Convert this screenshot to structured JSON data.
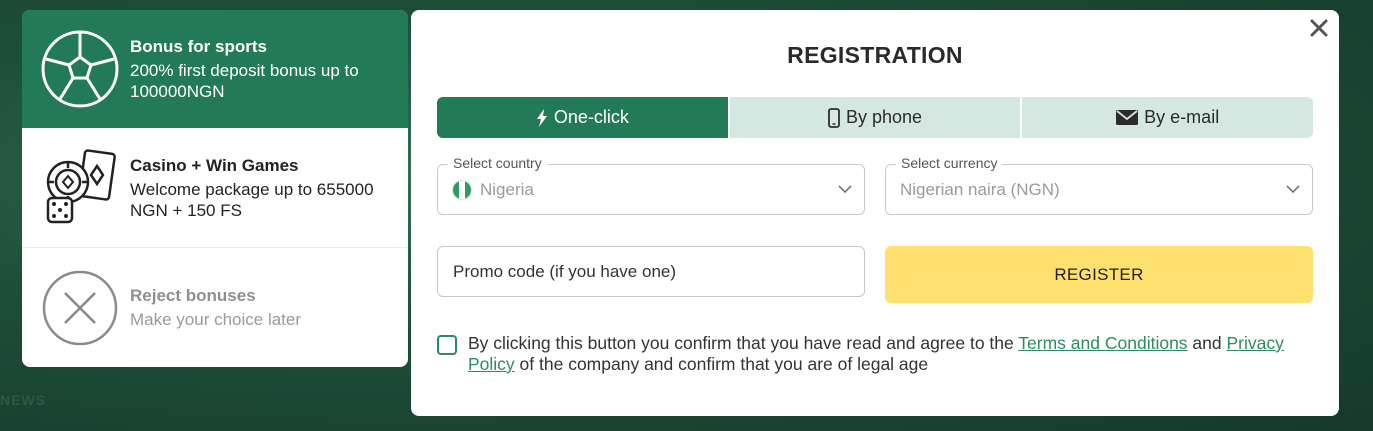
{
  "background": {
    "ghost_text": "NEWS"
  },
  "bonuses": [
    {
      "icon": "soccer-ball-icon",
      "title": "Bonus for sports",
      "description": "200% first deposit bonus up to 100000NGN",
      "selected": true
    },
    {
      "icon": "casino-icon",
      "title": "Casino + Win Games",
      "description": "Welcome package up to 655000 NGN + 150 FS",
      "selected": false
    },
    {
      "icon": "reject-x-icon",
      "title": "Reject bonuses",
      "description": "Make your choice later",
      "selected": false
    }
  ],
  "modal": {
    "title": "REGISTRATION",
    "close_icon": "close-icon",
    "tabs": [
      {
        "icon": "lightning-icon",
        "label": "One-click",
        "active": true
      },
      {
        "icon": "phone-icon",
        "label": "By phone",
        "active": false
      },
      {
        "icon": "envelope-icon",
        "label": "By e-mail",
        "active": false
      }
    ],
    "country": {
      "label": "Select country",
      "value": "Nigeria",
      "flag_icon": "nigeria-flag-icon"
    },
    "currency": {
      "label": "Select currency",
      "value": "Nigerian naira (NGN)"
    },
    "promo": {
      "placeholder": "Promo code (if you have one)",
      "value": ""
    },
    "register_label": "REGISTER",
    "consent": {
      "checked": false,
      "text_before": "By clicking this button you confirm that you have read and agree to the ",
      "terms_link": "Terms and Conditions",
      "text_and": " and ",
      "privacy_link": "Privacy Policy",
      "text_after": " of the company and confirm that you are of legal age"
    }
  },
  "colors": {
    "brand_green": "#237a57",
    "tab_inactive": "#d4e7e0",
    "register_yellow": "#fde06e",
    "link_green": "#2e8a64"
  }
}
